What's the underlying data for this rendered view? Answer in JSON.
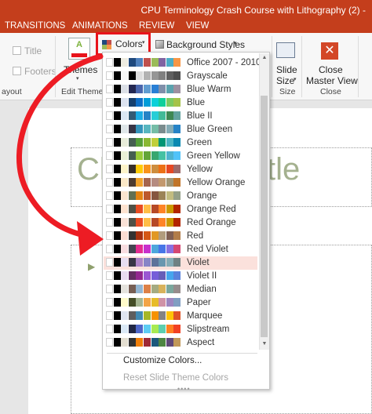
{
  "window": {
    "title": "CPU Terminology Crash Course with Lithography (2) -",
    "tabs": [
      "TRANSITIONS",
      "ANIMATIONS",
      "REVIEW",
      "VIEW"
    ]
  },
  "ribbon": {
    "checkboxes": [
      "Title",
      "Footers"
    ],
    "layout_group_label": "ayout",
    "themes_label": "Themes",
    "edit_theme_label": "Edit Theme",
    "colors_label": "Colors",
    "background_styles_label": "Background Styles",
    "slide_size_line1": "Slide",
    "slide_size_line2": "Size",
    "size_group_label": "Size",
    "close_line1": "Close",
    "close_line2": "Master View",
    "close_group_label": "Close"
  },
  "slide": {
    "title_left": "Cl",
    "title_right": "tle"
  },
  "colors_menu": {
    "selected_index": 15,
    "schemes": [
      {
        "name": "Office 2007 - 2010",
        "colors": [
          "#ffffff",
          "#000000",
          "#eeece1",
          "#1f497d",
          "#4f81bd",
          "#c0504d",
          "#9bbb59",
          "#8064a2",
          "#4bacc6",
          "#f79646"
        ]
      },
      {
        "name": "Grayscale",
        "colors": [
          "#ffffff",
          "#000000",
          "#f8f8f8",
          "#000000",
          "#dddddd",
          "#b2b2b2",
          "#969696",
          "#808080",
          "#5f5f5f",
          "#4d4d4d"
        ]
      },
      {
        "name": "Blue Warm",
        "colors": [
          "#ffffff",
          "#000000",
          "#dbdfe6",
          "#242852",
          "#4a66ac",
          "#629dd1",
          "#297fd5",
          "#7f8fa9",
          "#5aa2ae",
          "#9d90a0"
        ]
      },
      {
        "name": "Blue",
        "colors": [
          "#ffffff",
          "#000000",
          "#dce3f0",
          "#17406d",
          "#0f6fc6",
          "#009dd9",
          "#0bd0d9",
          "#10cf9b",
          "#7cca62",
          "#a5c249"
        ]
      },
      {
        "name": "Blue II",
        "colors": [
          "#ffffff",
          "#000000",
          "#dbe7f2",
          "#335b74",
          "#1cade4",
          "#2683c6",
          "#27ced7",
          "#42ba97",
          "#3e8853",
          "#62a39f"
        ]
      },
      {
        "name": "Blue Green",
        "colors": [
          "#ffffff",
          "#000000",
          "#dfe6e8",
          "#373545",
          "#3494ba",
          "#58b6c0",
          "#75bda7",
          "#7a8c8e",
          "#84acb6",
          "#2683c6"
        ]
      },
      {
        "name": "Green",
        "colors": [
          "#ffffff",
          "#000000",
          "#e7ecd9",
          "#455f51",
          "#549e39",
          "#8ab833",
          "#c0cf3a",
          "#029676",
          "#4ab5c4",
          "#0989b1"
        ]
      },
      {
        "name": "Green Yellow",
        "colors": [
          "#ffffff",
          "#000000",
          "#e9f0d6",
          "#455f51",
          "#99cb38",
          "#63a537",
          "#37a76f",
          "#44c1a3",
          "#4eb3cf",
          "#51c3f9"
        ]
      },
      {
        "name": "Yellow",
        "colors": [
          "#ffffff",
          "#000000",
          "#fdf3c9",
          "#39302a",
          "#ffca08",
          "#f8931d",
          "#ce8d3e",
          "#ec7016",
          "#e64823",
          "#9c6a6a"
        ]
      },
      {
        "name": "Yellow Orange",
        "colors": [
          "#ffffff",
          "#000000",
          "#fbe8c7",
          "#4e3b30",
          "#f0a22e",
          "#a5644e",
          "#b58b80",
          "#c3986d",
          "#a19574",
          "#c17529"
        ]
      },
      {
        "name": "Orange",
        "colors": [
          "#ffffff",
          "#000000",
          "#fbe5cf",
          "#637052",
          "#e48312",
          "#bd582c",
          "#865640",
          "#9b8357",
          "#c2bc80",
          "#94a088"
        ]
      },
      {
        "name": "Orange Red",
        "colors": [
          "#ffffff",
          "#000000",
          "#fde2cf",
          "#505046",
          "#e84c22",
          "#ffbd47",
          "#b64926",
          "#ff8427",
          "#cc9900",
          "#b22600"
        ]
      },
      {
        "name": "Red Orange",
        "colors": [
          "#ffffff",
          "#000000",
          "#f8e1d6",
          "#505046",
          "#e84c22",
          "#ffbd47",
          "#b64926",
          "#ff8427",
          "#cc9900",
          "#b22600"
        ]
      },
      {
        "name": "Red",
        "colors": [
          "#ffffff",
          "#000000",
          "#f9dcd2",
          "#323232",
          "#a5300f",
          "#d55816",
          "#e19825",
          "#b19c7d",
          "#7f5f52",
          "#b27d49"
        ]
      },
      {
        "name": "Red Violet",
        "colors": [
          "#ffffff",
          "#000000",
          "#f7dde0",
          "#454551",
          "#e32d91",
          "#c830cc",
          "#4ea6dc",
          "#4775e7",
          "#8971e1",
          "#d54773"
        ]
      },
      {
        "name": "Violet",
        "colors": [
          "#ffffff",
          "#000000",
          "#e6ddf0",
          "#373545",
          "#ad84c6",
          "#8784c7",
          "#5d739a",
          "#6997af",
          "#84acb6",
          "#6f8183"
        ]
      },
      {
        "name": "Violet II",
        "colors": [
          "#ffffff",
          "#000000",
          "#e9dcf0",
          "#632e62",
          "#92278f",
          "#9b57d3",
          "#755dd9",
          "#665eb8",
          "#45a5ed",
          "#5982db"
        ]
      },
      {
        "name": "Median",
        "colors": [
          "#ffffff",
          "#000000",
          "#e4e2dc",
          "#775f55",
          "#94b6d2",
          "#dd8047",
          "#a5ab81",
          "#d8b25c",
          "#7ba79d",
          "#968c8c"
        ]
      },
      {
        "name": "Paper",
        "colors": [
          "#ffffff",
          "#000000",
          "#fefac9",
          "#444d26",
          "#a5b592",
          "#f3a447",
          "#e7bc29",
          "#d092a7",
          "#9c85c0",
          "#809ec2"
        ]
      },
      {
        "name": "Marquee",
        "colors": [
          "#ffffff",
          "#000000",
          "#dfe5f0",
          "#5e5e5e",
          "#418ab3",
          "#a6b727",
          "#f69200",
          "#838383",
          "#fec306",
          "#df5327"
        ]
      },
      {
        "name": "Slipstream",
        "colors": [
          "#ffffff",
          "#000000",
          "#dbe9f6",
          "#212745",
          "#4e67c8",
          "#5eccf3",
          "#a7ea52",
          "#5dceaf",
          "#ff8021",
          "#f14124"
        ]
      },
      {
        "name": "Aspect",
        "colors": [
          "#ffffff",
          "#000000",
          "#e3ded1",
          "#323232",
          "#f07f09",
          "#9f2936",
          "#1b587c",
          "#4e8542",
          "#604878",
          "#c19859"
        ]
      }
    ],
    "customize_label": "Customize Colors...",
    "reset_label": "Reset Slide Theme Colors"
  }
}
